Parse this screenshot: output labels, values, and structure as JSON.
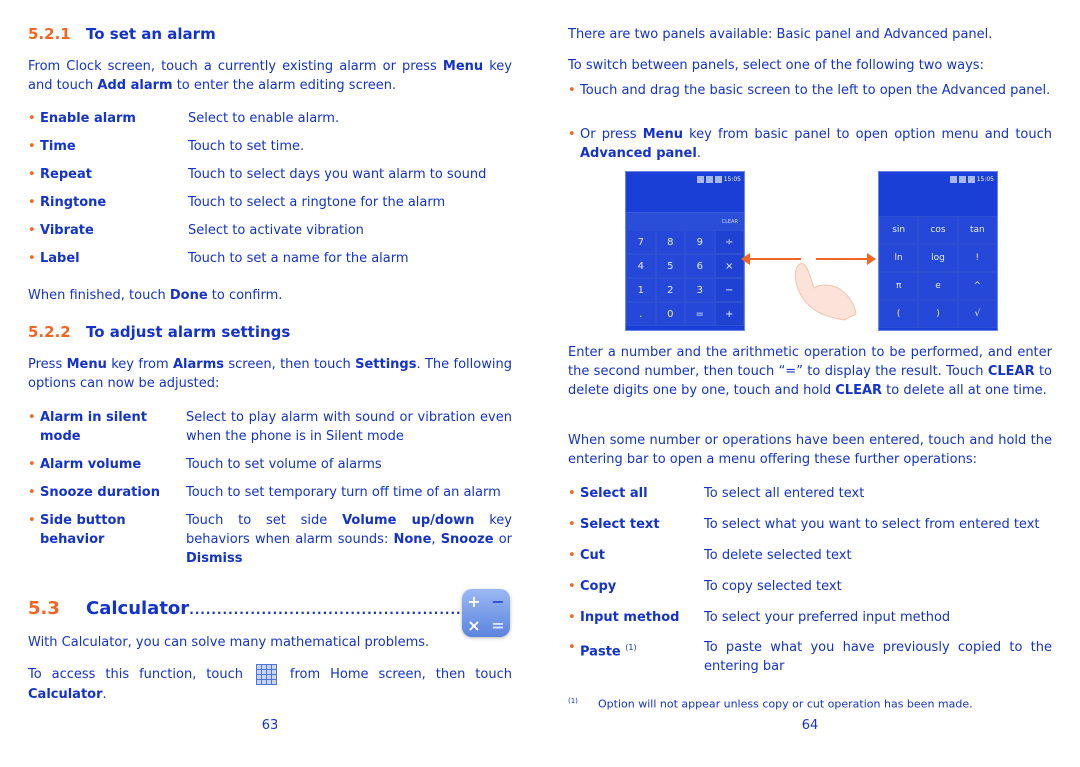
{
  "left_page": {
    "section_521": {
      "number": "5.2.1",
      "title": "To set an alarm",
      "intro_parts": [
        "From Clock screen, touch a currently existing alarm or press ",
        "Menu",
        " key and touch ",
        "Add alarm",
        " to enter the alarm editing screen."
      ],
      "items": [
        {
          "term": "Enable alarm",
          "desc": "Select to enable alarm."
        },
        {
          "term": "Time",
          "desc": "Touch to set time."
        },
        {
          "term": "Repeat",
          "desc": "Touch to select days you want alarm to sound"
        },
        {
          "term": "Ringtone",
          "desc": "Touch to select a ringtone for the alarm"
        },
        {
          "term": "Vibrate",
          "desc": "Select to activate vibration"
        },
        {
          "term": "Label",
          "desc": "Touch to set a name for the alarm"
        }
      ],
      "outro_parts": [
        "When finished, touch ",
        "Done",
        " to confirm."
      ]
    },
    "section_522": {
      "number": "5.2.2",
      "title": "To adjust alarm settings",
      "intro_parts": [
        "Press ",
        "Menu",
        " key from ",
        "Alarms",
        " screen, then touch ",
        "Settings",
        ". The following options can now be adjusted:"
      ],
      "items": [
        {
          "term": "Alarm in silent mode",
          "desc": "Select to play alarm with sound or vibration even when the phone is in Silent mode"
        },
        {
          "term": "Alarm volume",
          "desc": "Touch to set volume of alarms"
        },
        {
          "term": "Snooze duration",
          "desc": "Touch to set temporary turn off time of an alarm"
        },
        {
          "term": "Side button behavior",
          "desc_parts": [
            "Touch to set side ",
            "Volume up/down",
            " key behaviors when alarm sounds: ",
            "None",
            ", ",
            "Snooze",
            " or ",
            "Dismiss"
          ]
        }
      ]
    },
    "section_53": {
      "number": "5.3",
      "title": "Calculator",
      "leader": "..................................................",
      "icon": "calculator-app-icon",
      "icon_glyphs": [
        "+",
        "−",
        "×",
        "="
      ],
      "para1": "With Calculator, you can solve many mathematical problems.",
      "para2_parts": [
        "To access this function, touch ",
        " from Home screen, then touch ",
        "Calculator",
        "."
      ],
      "inline_icon": "apps-grid-icon"
    },
    "page_number": "63"
  },
  "right_page": {
    "para1": "There are two panels available: Basic panel and Advanced panel.",
    "para2": "To switch between panels, select one of the following two ways:",
    "bullets": [
      {
        "parts": [
          "Touch and drag the basic screen to the left to open the Advanced panel."
        ]
      },
      {
        "parts": [
          "Or press ",
          "Menu",
          " key from basic panel to open option menu and touch ",
          "Advanced panel",
          "."
        ]
      }
    ],
    "basic_panel": {
      "time": "15:05",
      "clear_label": "CLEAR",
      "keys": [
        "7",
        "8",
        "9",
        "÷",
        "4",
        "5",
        "6",
        "×",
        "1",
        "2",
        "3",
        "−",
        ".",
        "0",
        "=",
        "+"
      ]
    },
    "advanced_panel": {
      "time": "15:05",
      "keys": [
        "sin",
        "cos",
        "tan",
        "ln",
        "log",
        "!",
        "π",
        "e",
        "^",
        "(",
        ")",
        "√"
      ]
    },
    "para3_parts": [
      "Enter a number and the arithmetic operation to be performed, and enter the second number, then touch “=” to display the result. Touch ",
      "CLEAR",
      " to delete digits one by one, touch and hold ",
      "CLEAR",
      " to delete all at one time."
    ],
    "para4": "When some number or operations have been entered, touch and hold the entering bar to open a menu offering these further operations:",
    "items": [
      {
        "term": "Select all",
        "desc": "To select all entered text"
      },
      {
        "term": "Select text",
        "desc": "To select what you want to select from entered text"
      },
      {
        "term": "Cut",
        "desc": "To delete selected text"
      },
      {
        "term": "Copy",
        "desc": "To copy selected text"
      },
      {
        "term": "Input method",
        "desc": "To select your preferred input method"
      },
      {
        "term": "Paste",
        "footnote_ref": "(1)",
        "desc": "To paste what you have previously copied to the entering bar"
      }
    ],
    "footnote": {
      "mark": "(1)",
      "text": "Option will not appear unless copy or cut operation has been made."
    },
    "page_number": "64"
  },
  "colors": {
    "text": "#1433cc",
    "accent": "#f26522",
    "panel": "#1a3fd6"
  }
}
